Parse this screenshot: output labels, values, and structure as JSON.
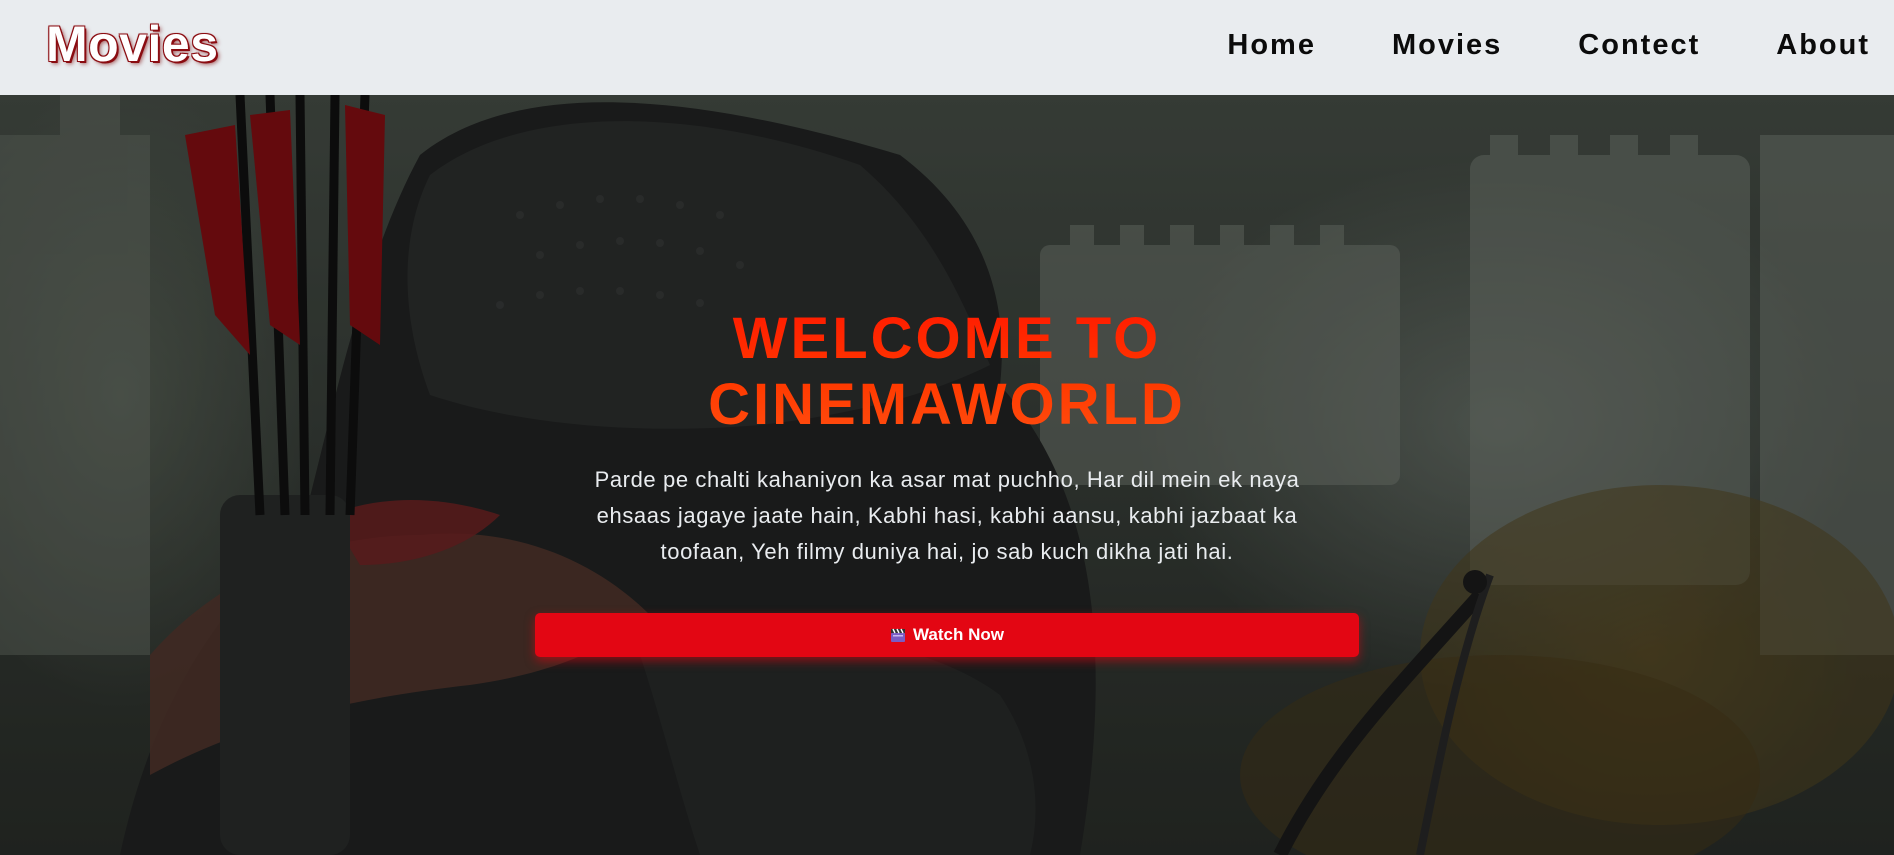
{
  "header": {
    "logo": "Movies",
    "nav": [
      {
        "label": "Home"
      },
      {
        "label": "Movies"
      },
      {
        "label": "Contect"
      },
      {
        "label": "About"
      }
    ]
  },
  "hero": {
    "title": "WELCOME TO CINEMAWORLD",
    "text": "Parde pe chalti kahaniyon ka asar mat puchho, Har dil mein ek naya ehsaas jagaye jaate hain, Kabhi hasi, kabhi aansu, kabhi jazbaat ka toofaan, Yeh filmy duniya hai, jo sab kuch dikha jati hai.",
    "button_label": "Watch Now",
    "button_icon": "clapperboard-icon"
  },
  "colors": {
    "header_bg": "#e9ecef",
    "accent_red": "#e30613",
    "title_orange": "#ff2a00"
  }
}
